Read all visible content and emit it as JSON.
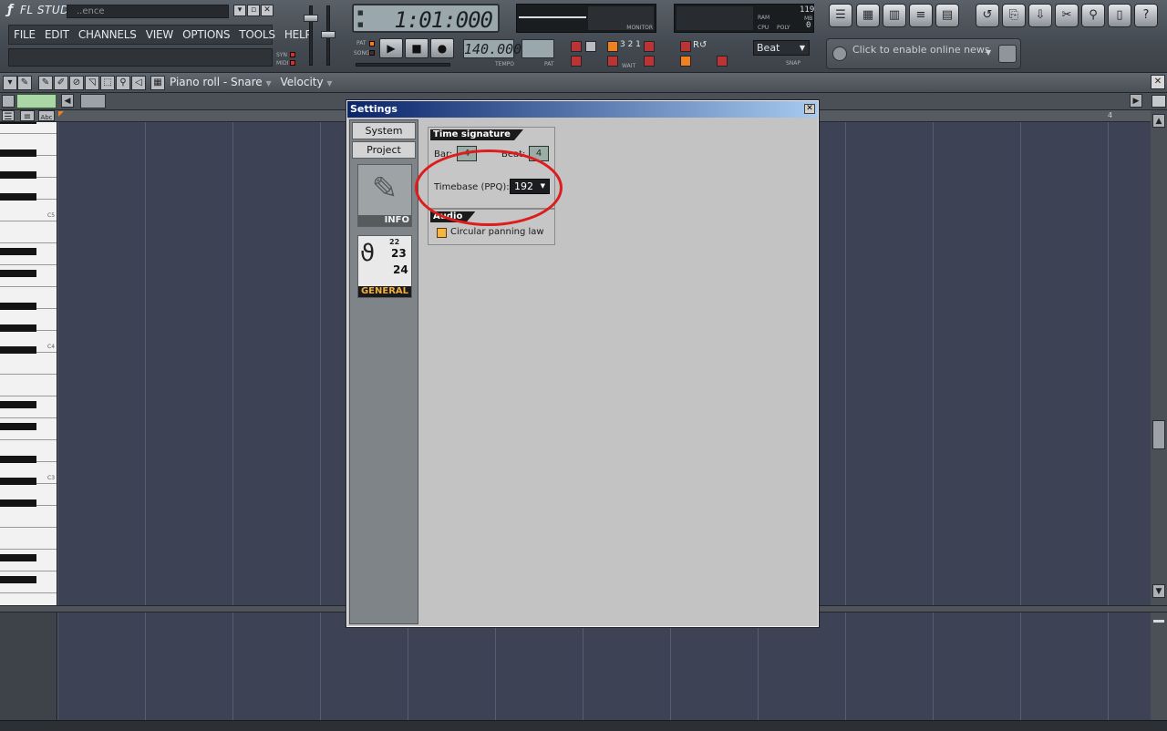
{
  "app": {
    "name": "FL STUDIO",
    "song_name": "..ence",
    "window_buttons": [
      "▾",
      "▫",
      "✕"
    ]
  },
  "menu": [
    "FILE",
    "EDIT",
    "CHANNELS",
    "VIEW",
    "OPTIONS",
    "TOOLS",
    "HELP"
  ],
  "toolbar": {
    "syn_label": "SYN",
    "midi_label": "MIDI",
    "time": "1:01:000",
    "pat_label": "PAT",
    "song_label": "SONG",
    "tempo": "140.000",
    "tempo_label": "TEMPO",
    "pat_box_label": "PAT",
    "monitor_label": "MONITOR",
    "ram_label": "RAM",
    "ram_value": "119",
    "mb_label": "MB",
    "cpu_label": "CPU",
    "poly_label": "POLY",
    "poly_value": "0",
    "wait_label": "WAIT",
    "snap_value": "Beat",
    "snap_label": "SNAP",
    "news_text": "Click to enable online news"
  },
  "piano_roll": {
    "title": "Piano roll - Snare",
    "target": "Velocity",
    "ruler_marker": "4",
    "octaves": [
      "C5",
      "C4",
      "C3"
    ]
  },
  "settings": {
    "title": "Settings",
    "tabs": [
      "System",
      "Project"
    ],
    "tiles": [
      {
        "label": "INFO"
      },
      {
        "label": "GENERAL",
        "calendar": [
          "22",
          "23",
          "24"
        ]
      }
    ],
    "time_signature": {
      "heading": "Time signature",
      "bar_label": "Bar:",
      "bar_value": "4",
      "beat_label": "Beat:",
      "beat_value": "4",
      "timebase_label": "Timebase (PPQ):",
      "timebase_value": "192"
    },
    "audio": {
      "heading": "Audio",
      "circular_panning_label": "Circular panning law",
      "circular_panning_checked": false
    }
  },
  "colors": {
    "annotation_ring": "#dd1d1d",
    "grid_bg": "#3d4254",
    "dialog_titlebar": "#0a246a"
  }
}
